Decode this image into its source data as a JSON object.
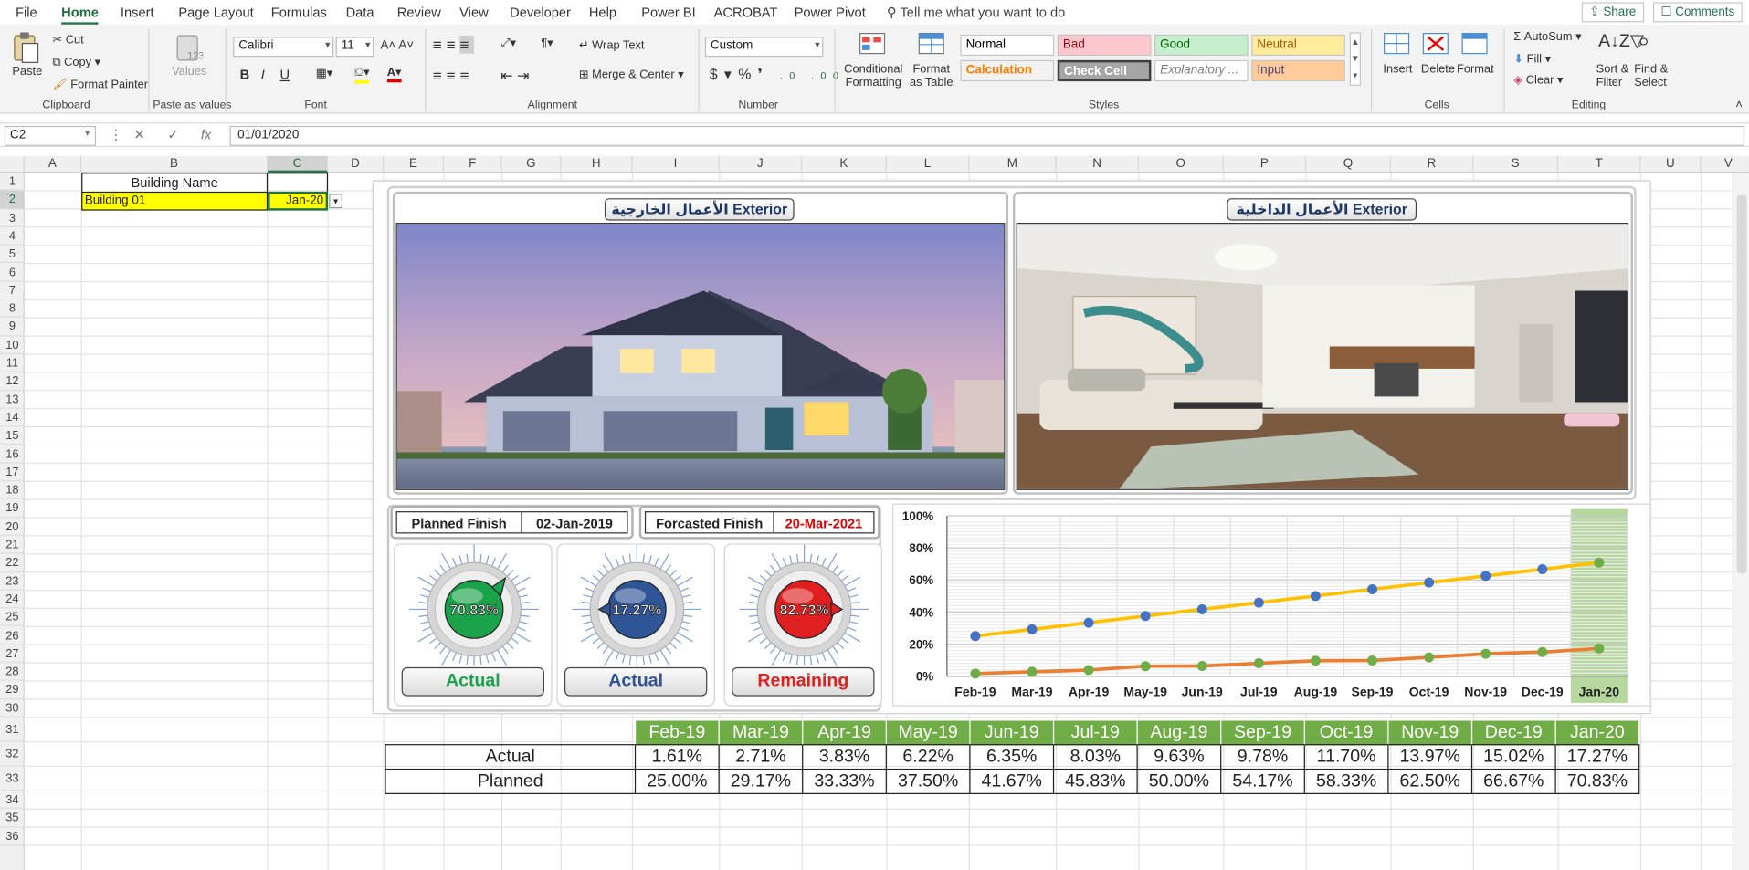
{
  "menu": {
    "tabs": [
      "File",
      "Home",
      "Insert",
      "Page Layout",
      "Formulas",
      "Data",
      "Review",
      "View",
      "Developer",
      "Help",
      "Power BI",
      "ACROBAT",
      "Power Pivot"
    ],
    "active": "Home",
    "tell_me": "Tell me what you want to do",
    "share": "Share",
    "comments": "Comments"
  },
  "ribbon": {
    "clipboard": {
      "paste": "Paste",
      "cut": "Cut",
      "copy": "Copy",
      "format_painter": "Format Painter",
      "label": "Clipboard"
    },
    "paste_values": {
      "values": "Values",
      "label": "Paste as values"
    },
    "font": {
      "name": "Calibri",
      "size": "11",
      "bold": "B",
      "italic": "I",
      "underline": "U",
      "label": "Font"
    },
    "alignment": {
      "wrap": "Wrap Text",
      "merge": "Merge & Center",
      "label": "Alignment"
    },
    "number": {
      "format": "Custom",
      "label": "Number"
    },
    "styles": {
      "conditional": "Conditional Formatting",
      "format_table": "Format as Table",
      "cells": [
        {
          "name": "Normal",
          "bg": "#ffffff",
          "fg": "#000000"
        },
        {
          "name": "Bad",
          "bg": "#ffc7ce",
          "fg": "#9c0006"
        },
        {
          "name": "Good",
          "bg": "#c6efce",
          "fg": "#006100"
        },
        {
          "name": "Neutral",
          "bg": "#ffeb9c",
          "fg": "#9c5700"
        },
        {
          "name": "Calculation",
          "bg": "#f2f2f2",
          "fg": "#fa7d00"
        },
        {
          "name": "Check Cell",
          "bg": "#a5a5a5",
          "fg": "#ffffff"
        },
        {
          "name": "Explanatory ...",
          "bg": "#ffffff",
          "fg": "#7f7f7f"
        },
        {
          "name": "Input",
          "bg": "#ffcc99",
          "fg": "#3f3f76"
        }
      ],
      "label": "Styles"
    },
    "cells": {
      "insert": "Insert",
      "delete": "Delete",
      "format": "Format",
      "label": "Cells"
    },
    "editing": {
      "autosum": "AutoSum",
      "fill": "Fill",
      "clear": "Clear",
      "sort": "Sort & Filter",
      "find": "Find & Select",
      "label": "Editing"
    }
  },
  "formula_bar": {
    "name_box": "C2",
    "value": "01/01/2020",
    "fx": "fx"
  },
  "columns": [
    "A",
    "B",
    "C",
    "D",
    "E",
    "F",
    "G",
    "H",
    "I",
    "J",
    "K",
    "L",
    "M",
    "N",
    "O",
    "P",
    "Q",
    "R",
    "S",
    "T",
    "U",
    "V"
  ],
  "rows": [
    "1",
    "2",
    "3",
    "4",
    "5",
    "6",
    "7",
    "8",
    "9",
    "10",
    "11",
    "12",
    "13",
    "14",
    "15",
    "16",
    "17",
    "18",
    "19",
    "20",
    "21",
    "22",
    "23",
    "24",
    "25",
    "26",
    "27",
    "28",
    "29",
    "30",
    "31",
    "32",
    "33",
    "34",
    "35",
    "36"
  ],
  "sheet": {
    "building_header": "Building Name",
    "building_value": "Building 01",
    "date_value": "Jan-20"
  },
  "dashboard": {
    "exterior_title": "الأعمال الخارجية  Exterior",
    "interior_title": "الأعمال الداخلية  Exterior",
    "planned_finish_label": "Planned Finish",
    "planned_finish_value": "02-Jan-2019",
    "forecast_finish_label": "Forcasted Finish",
    "forecast_finish_value": "20-Mar-2021",
    "gauges": [
      {
        "value": "70.83%",
        "label": "Actual",
        "color": "#1aa34a",
        "label_color": "#1aa34a"
      },
      {
        "value": "17.27%",
        "label": "Actual",
        "color": "#2f5597",
        "label_color": "#2f5597"
      },
      {
        "value": "82.73%",
        "label": "Remaining",
        "color": "#e02020",
        "label_color": "#e02020"
      }
    ]
  },
  "chart_data": {
    "type": "line",
    "categories": [
      "Feb-19",
      "Mar-19",
      "Apr-19",
      "May-19",
      "Jun-19",
      "Jul-19",
      "Aug-19",
      "Sep-19",
      "Oct-19",
      "Nov-19",
      "Dec-19",
      "Jan-20"
    ],
    "series": [
      {
        "values": [
          25.0,
          29.17,
          33.33,
          37.5,
          41.67,
          45.83,
          50.0,
          54.17,
          58.33,
          62.5,
          66.67,
          70.83
        ],
        "line_color": "#ffc000",
        "marker_color": "#4472c4"
      },
      {
        "values": [
          1.61,
          2.71,
          3.83,
          6.22,
          6.35,
          8.03,
          9.63,
          9.78,
          11.7,
          13.97,
          15.02,
          17.27
        ],
        "line_color": "#ed7d31",
        "marker_color": "#70ad47"
      }
    ],
    "yticks": [
      "0%",
      "20%",
      "40%",
      "60%",
      "80%",
      "100%"
    ],
    "ylim": [
      0,
      100
    ],
    "highlight": "Jan-20",
    "highlight_color": "#a9d18e"
  },
  "table": {
    "months": [
      "Feb-19",
      "Mar-19",
      "Apr-19",
      "May-19",
      "Jun-19",
      "Jul-19",
      "Aug-19",
      "Sep-19",
      "Oct-19",
      "Nov-19",
      "Dec-19",
      "Jan-20"
    ],
    "actual_label": "Actual",
    "planned_label": "Planned",
    "actual": [
      "1.61%",
      "2.71%",
      "3.83%",
      "6.22%",
      "6.35%",
      "8.03%",
      "9.63%",
      "9.78%",
      "11.70%",
      "13.97%",
      "15.02%",
      "17.27%"
    ],
    "planned": [
      "25.00%",
      "29.17%",
      "33.33%",
      "37.50%",
      "41.67%",
      "45.83%",
      "50.00%",
      "54.17%",
      "58.33%",
      "62.50%",
      "66.67%",
      "70.83%"
    ]
  }
}
